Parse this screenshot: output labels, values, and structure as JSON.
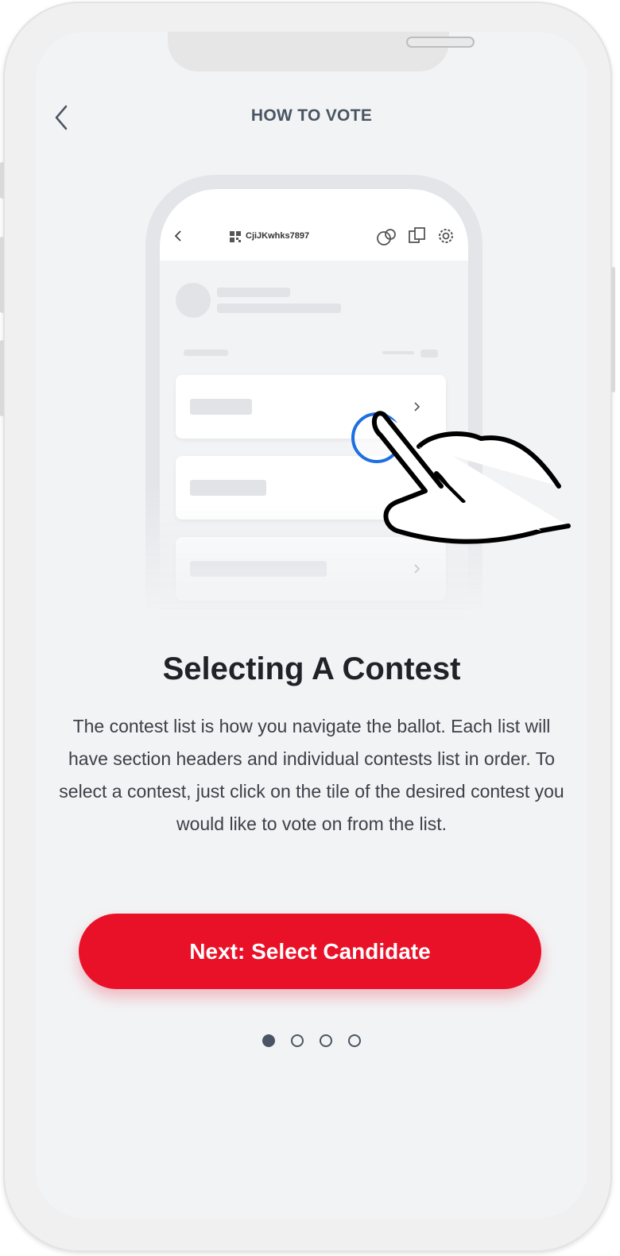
{
  "header": {
    "title": "HOW TO VOTE"
  },
  "illustration": {
    "ballot_code": "CjiJKwhks7897"
  },
  "content": {
    "title": "Selecting A Contest",
    "description": "The contest list is how you navigate the ballot. Each list will have section headers and individual contests list in order.  To select a contest, just click on the tile of the desired contest you would like to vote on from the list."
  },
  "next_button": {
    "label": "Next: Select Candidate"
  },
  "pagination": {
    "total": 4,
    "current": 1
  },
  "colors": {
    "accent": "#e91128",
    "text_dark": "#1f2328",
    "header": "#4a5563",
    "background": "#f2f3f5"
  }
}
